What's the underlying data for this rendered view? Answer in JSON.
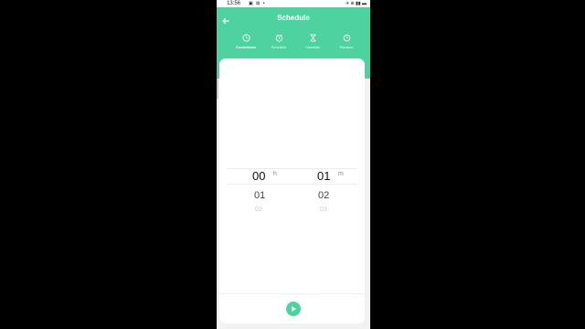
{
  "statusbar": {
    "time": "13:56",
    "left_icons": "▣ ⊠ •",
    "right_icons": "✈ ⊕ ▮▮ ▬"
  },
  "header": {
    "title": "Schedule",
    "back_icon": "arrow-left-icon"
  },
  "tabs": [
    {
      "label": "Countdown",
      "icon": "timer-icon",
      "active": true
    },
    {
      "label": "Schedule",
      "icon": "alarm-icon",
      "active": false
    },
    {
      "label": "Circulate",
      "icon": "hourglass-icon",
      "active": false
    },
    {
      "label": "Random",
      "icon": "clock-icon",
      "active": false
    }
  ],
  "picker": {
    "hours": {
      "selected": "00",
      "unit": "h",
      "next": "01",
      "next2": "02"
    },
    "minutes": {
      "selected": "01",
      "unit": "m",
      "next": "02",
      "next2": "03"
    }
  },
  "actions": {
    "play_icon": "play-icon"
  },
  "colors": {
    "accent": "#4ed3a0",
    "background": "#000000"
  }
}
